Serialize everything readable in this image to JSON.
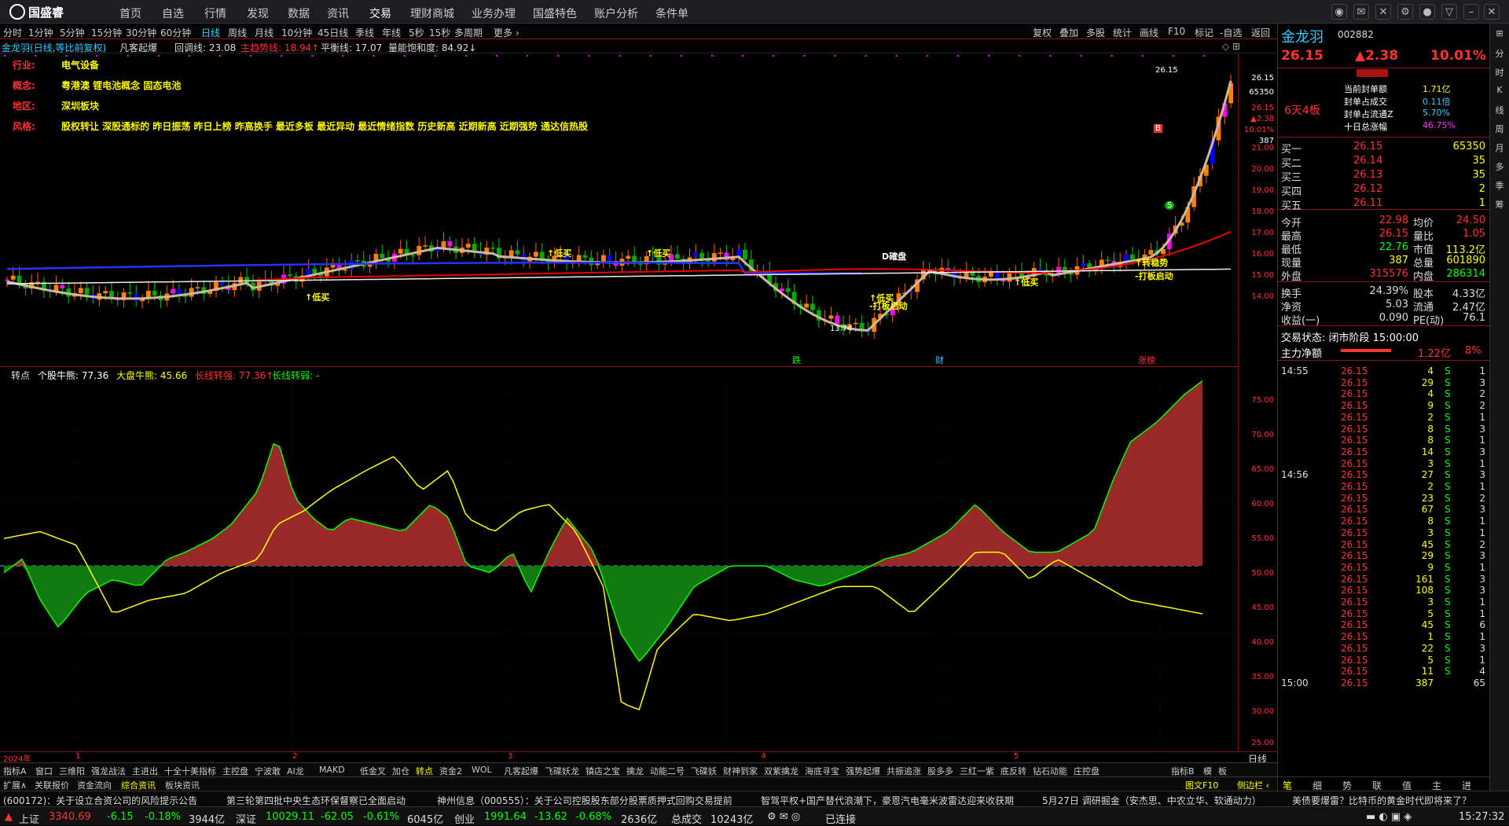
{
  "app": {
    "logo": "国盛睿",
    "nav": [
      "首页",
      "自选",
      "行情",
      "发现",
      "数据",
      "资讯",
      "交易",
      "理财商城",
      "业务办理",
      "国盛特色",
      "账户分析",
      "条件单"
    ],
    "active_nav": "交易"
  },
  "periods": {
    "items": [
      "分时",
      "1分钟",
      "5分钟",
      "15分钟",
      "30分钟",
      "60分钟",
      "日线",
      "周线",
      "月线",
      "10分钟",
      "45日线",
      "季线",
      "年线",
      "5秒",
      "15秒",
      "多周期",
      "更多 ›"
    ],
    "active": "日线"
  },
  "chart_tools": [
    "复权",
    "叠加",
    "多股",
    "统计",
    "画线",
    "F10",
    "标记",
    "-自选",
    "返回"
  ],
  "main_header": {
    "stock": "金龙羽(日线,等比前复权)",
    "indicator": "凡客起爆",
    "l1": "回调线: 23.08",
    "l2": "主趋势线: 18.94↑",
    "l3": "平衡线: 17.07",
    "l4": "量能饱和度: 84.92↓"
  },
  "info": [
    {
      "k": "行业:",
      "v": "电气设备"
    },
    {
      "k": "概念:",
      "v": "粤港澳 锂电池概念 固态电池"
    },
    {
      "k": "地区:",
      "v": "深圳板块"
    },
    {
      "k": "风格:",
      "v": "股权转让 深股通标的 昨日振荡 昨日上榜 昨高换手 最近多板 最近异动 最近情绪指数 历史新高 近期新高 近期强势 通达信热股"
    }
  ],
  "price_axis": [
    "26.15",
    "65350",
    "26.15",
    "▲2.38",
    "10.01%",
    "387",
    "21.00",
    "20.00",
    "19.00",
    "18.00",
    "17.00",
    "16.00",
    "15.00",
    "14.00"
  ],
  "annotations": {
    "high": "26.15",
    "low": "13.74",
    "buy_labels": [
      "↑低买",
      "↑低买",
      "↑低买",
      "↑低买",
      "↑低买"
    ],
    "start_labels": [
      "-打板启动",
      "-打板启动"
    ],
    "d": "D確盘",
    "stable": "↑转稳势",
    "flag1": "跌",
    "flag2": "财",
    "flag3": "涨榜",
    "b": "B",
    "s": "S"
  },
  "ind_header": {
    "name": "转点",
    "a": "个股牛熊: 77.36",
    "b": "大盘牛熊: 45.66",
    "c": "长线转强: 77.36↑",
    "d": "长线转弱: -"
  },
  "ind_axis": [
    "75.00",
    "70.00",
    "65.00",
    "60.00",
    "55.00",
    "50.00",
    "45.00",
    "40.00",
    "35.00",
    "30.00",
    "25.00"
  ],
  "x_axis": [
    "2024年",
    "1",
    "2",
    "3",
    "4",
    "5"
  ],
  "x_period": "日线",
  "bottom_tabs": [
    "指标A",
    "窗口",
    "三维阳",
    "强龙战法",
    "主进出",
    "十全十美指标",
    "主控盘",
    "宁波敢",
    "AI龙",
    "MAKD",
    "低金叉",
    "加仓",
    "转点",
    "资金2",
    "WOL",
    "凡客起爆",
    "飞碟妖龙",
    "镇店之宝",
    "擒龙",
    "动能二号",
    "飞碟妖",
    "财神到家",
    "双紫擒龙",
    "海底寻宝",
    "强势起爆",
    "共振追涨",
    "股多多",
    "三红一紫",
    "底反转",
    "钻石动能",
    "庄控盘",
    "指标B",
    "模",
    "板"
  ],
  "bottom_tabs2": [
    "扩展∧",
    "关联报价",
    "资金流向",
    "综合资讯",
    "板块资讯"
  ],
  "side_tabs": [
    "图文F10",
    "侧边栏 ‹"
  ],
  "news": [
    "(600172)：关于设立合资公司的风险提示公告",
    "第三轮第四批中央生态环保督察已全面启动",
    "神州信息（000555）：关于公司控股股东部分股票质押式回购交易提前",
    "智驾平权+国产替代浪潮下，豪恩汽电毫米波雷达迎来收获期",
    "5月27日 调研掘金（安杰思、中农立华、软通动力）",
    "美债要爆雷？比特币的黄金时代即将来了？"
  ],
  "status": {
    "sh_l": "上证",
    "sh_v": "3340.69",
    "sh_c": "-6.15",
    "sh_p": "-0.18%",
    "sh_a": "3944亿",
    "sz_l": "深证",
    "sz_v": "10029.11",
    "sz_c": "-62.05",
    "sz_p": "-0.61%",
    "sz_a": "6045亿",
    "cy_l": "创业",
    "cy_v": "1991.64",
    "cy_c": "-13.62",
    "cy_p": "-0.68%",
    "cy_a": "2636亿",
    "tot_l": "总成交",
    "tot": "10243亿",
    "conn": "已连接",
    "time": "15:27:32"
  },
  "quote": {
    "name": "金龙羽",
    "code": "002882",
    "price": "26.15",
    "chg": "▲2.38",
    "pct": "10.01%",
    "board": "6天4板",
    "limit": [
      {
        "k": "当前封单额",
        "v": "1.71亿"
      },
      {
        "k": "封单占成交",
        "v": "0.11倍"
      },
      {
        "k": "封单占流通Z",
        "v": "5.70%"
      },
      {
        "k": "十日总涨幅",
        "v": "46.75%"
      }
    ],
    "bids": [
      {
        "k": "买一",
        "p": "26.15",
        "v": "65350"
      },
      {
        "k": "买二",
        "p": "26.14",
        "v": "35"
      },
      {
        "k": "买三",
        "p": "26.13",
        "v": "35"
      },
      {
        "k": "买四",
        "p": "26.12",
        "v": "2"
      },
      {
        "k": "买五",
        "p": "26.11",
        "v": "1"
      }
    ],
    "stats": [
      [
        "今开",
        "22.98",
        "均价",
        "24.50"
      ],
      [
        "最高",
        "26.15",
        "量比",
        "1.05"
      ],
      [
        "最低",
        "22.76",
        "市值",
        "113.2亿"
      ],
      [
        "现量",
        "387",
        "总量",
        "601890"
      ],
      [
        "外盘",
        "315576",
        "内盘",
        "286314"
      ]
    ],
    "stats2": [
      [
        "换手",
        "24.39%",
        "股本",
        "4.33亿"
      ],
      [
        "净资",
        "5.03",
        "流通",
        "2.47亿"
      ],
      [
        "收益(一)",
        "0.090",
        "PE(动)",
        "76.1"
      ]
    ],
    "trade_state": "交易状态: 闭市阶段 15:00:00",
    "main_flow": "主力净额",
    "main_flow_v": "1.22亿",
    "main_flow_p": "8%",
    "ticks": [
      {
        "t": "14:55",
        "p": "26.15",
        "v": "4",
        "s": "S",
        "n": "1"
      },
      {
        "t": "",
        "p": "26.15",
        "v": "29",
        "s": "S",
        "n": "3"
      },
      {
        "t": "",
        "p": "26.15",
        "v": "4",
        "s": "S",
        "n": "2"
      },
      {
        "t": "",
        "p": "26.15",
        "v": "9",
        "s": "S",
        "n": "2"
      },
      {
        "t": "",
        "p": "26.15",
        "v": "2",
        "s": "S",
        "n": "1"
      },
      {
        "t": "",
        "p": "26.15",
        "v": "8",
        "s": "S",
        "n": "3"
      },
      {
        "t": "",
        "p": "26.15",
        "v": "8",
        "s": "S",
        "n": "1"
      },
      {
        "t": "",
        "p": "26.15",
        "v": "14",
        "s": "S",
        "n": "3"
      },
      {
        "t": "",
        "p": "26.15",
        "v": "3",
        "s": "S",
        "n": "1"
      },
      {
        "t": "14:56",
        "p": "26.15",
        "v": "27",
        "s": "S",
        "n": "3"
      },
      {
        "t": "",
        "p": "26.15",
        "v": "2",
        "s": "S",
        "n": "1"
      },
      {
        "t": "",
        "p": "26.15",
        "v": "23",
        "s": "S",
        "n": "2"
      },
      {
        "t": "",
        "p": "26.15",
        "v": "67",
        "s": "S",
        "n": "3"
      },
      {
        "t": "",
        "p": "26.15",
        "v": "8",
        "s": "S",
        "n": "1"
      },
      {
        "t": "",
        "p": "26.15",
        "v": "3",
        "s": "S",
        "n": "1"
      },
      {
        "t": "",
        "p": "26.15",
        "v": "45",
        "s": "S",
        "n": "2"
      },
      {
        "t": "",
        "p": "26.15",
        "v": "29",
        "s": "S",
        "n": "3"
      },
      {
        "t": "",
        "p": "26.15",
        "v": "9",
        "s": "S",
        "n": "1"
      },
      {
        "t": "",
        "p": "26.15",
        "v": "161",
        "s": "S",
        "n": "3"
      },
      {
        "t": "",
        "p": "26.15",
        "v": "108",
        "s": "S",
        "n": "3"
      },
      {
        "t": "",
        "p": "26.15",
        "v": "3",
        "s": "S",
        "n": "1"
      },
      {
        "t": "",
        "p": "26.15",
        "v": "5",
        "s": "S",
        "n": "1"
      },
      {
        "t": "",
        "p": "26.15",
        "v": "45",
        "s": "S",
        "n": "6"
      },
      {
        "t": "",
        "p": "26.15",
        "v": "1",
        "s": "S",
        "n": "1"
      },
      {
        "t": "",
        "p": "26.15",
        "v": "22",
        "s": "S",
        "n": "3"
      },
      {
        "t": "",
        "p": "26.15",
        "v": "5",
        "s": "S",
        "n": "1"
      },
      {
        "t": "",
        "p": "26.15",
        "v": "11",
        "s": "S",
        "n": "4"
      },
      {
        "t": "15:00",
        "p": "26.15",
        "v": "387",
        "s": "",
        "n": "65"
      }
    ],
    "tick_tabs": [
      "笔",
      "细",
      "势",
      "联",
      "值",
      "主",
      "进"
    ]
  },
  "right_bar": [
    "⊞",
    "分",
    "时",
    "K",
    "线",
    "周",
    "月",
    "多",
    "季",
    "筹"
  ],
  "chart_data": {
    "type": "candlestick",
    "series": [
      {
        "name": "个股牛熊",
        "last": 77.36
      },
      {
        "name": "大盘牛熊",
        "last": 45.66
      }
    ],
    "price_high": 26.15,
    "price_low": 13.74,
    "indicator_ylim": [
      25,
      75
    ]
  }
}
